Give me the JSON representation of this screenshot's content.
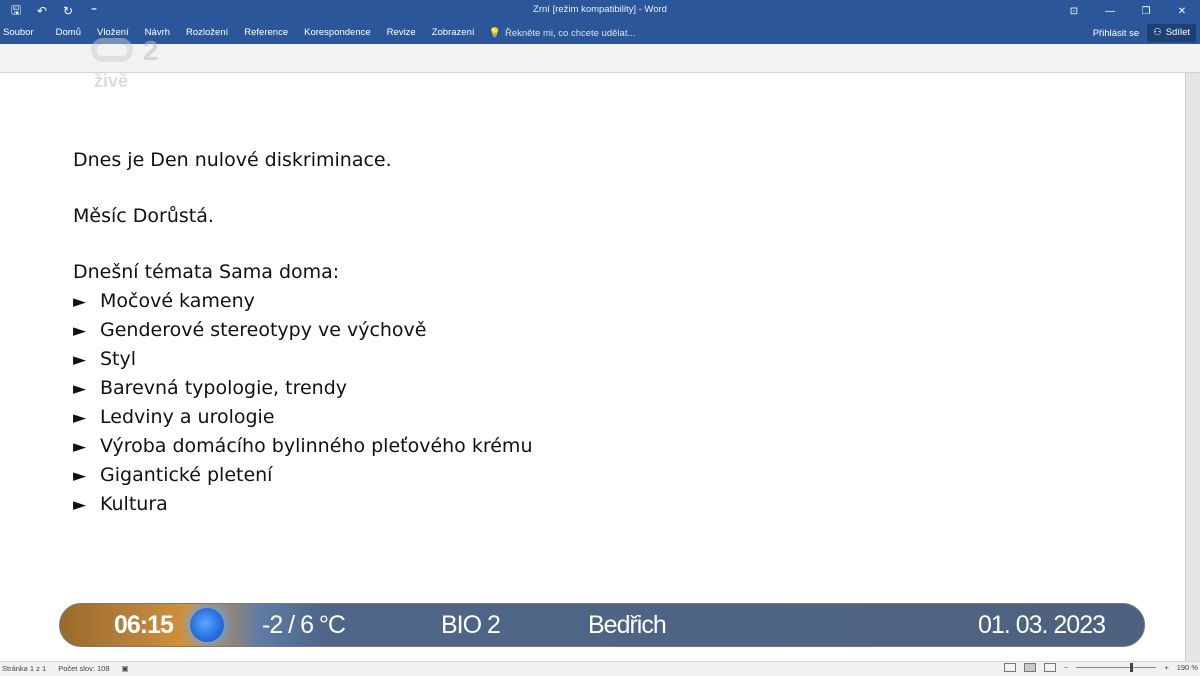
{
  "titlebar": {
    "title": "Zrní [režim kompatibility] - Word",
    "qat": [
      {
        "icon": "save-icon",
        "glyph": "🖫"
      },
      {
        "icon": "undo-icon",
        "glyph": "↶"
      },
      {
        "icon": "redo-icon",
        "glyph": "↻"
      },
      {
        "icon": "customize-qat-icon",
        "glyph": "⁼"
      }
    ],
    "window_controls": [
      {
        "icon": "ribbon-display-icon",
        "glyph": "⊡"
      },
      {
        "icon": "minimize-icon",
        "glyph": "—"
      },
      {
        "icon": "restore-icon",
        "glyph": "❐"
      },
      {
        "icon": "close-icon",
        "glyph": "✕"
      }
    ]
  },
  "ribbon": {
    "tabs": [
      "Soubor",
      "Domů",
      "Vložení",
      "Návrh",
      "Rozložení",
      "Reference",
      "Korespondence",
      "Revize",
      "Zobrazení"
    ],
    "tell_me": "Řekněte mi, co chcete udělat...",
    "sign_in": "Přihlásit se",
    "share": "Sdílet"
  },
  "watermark": {
    "number": "2",
    "live": "živě"
  },
  "document": {
    "line1": "Dnes je Den nulové diskriminace.",
    "line2": "Měsíc Dorůstá.",
    "topics_heading": "Dnešní témata Sama doma:",
    "bullet_glyph": "►",
    "topics": [
      "Močové kameny",
      "Genderové stereotypy ve výchově",
      "Styl",
      "Barevná typologie, trendy",
      "Ledviny a urologie",
      "Výroba domácího bylinného pleťového krému",
      "Gigantické pletení",
      "Kultura"
    ]
  },
  "ticker": {
    "time": "06:15",
    "temperature": "-2 / 6 °C",
    "channel": "BIO 2",
    "nameday": "Bedřich",
    "date": "01. 03. 2023"
  },
  "statusbar": {
    "page": "Stránka 1 z 1",
    "words": "Počet slov: 108",
    "zoom": "190 %"
  }
}
